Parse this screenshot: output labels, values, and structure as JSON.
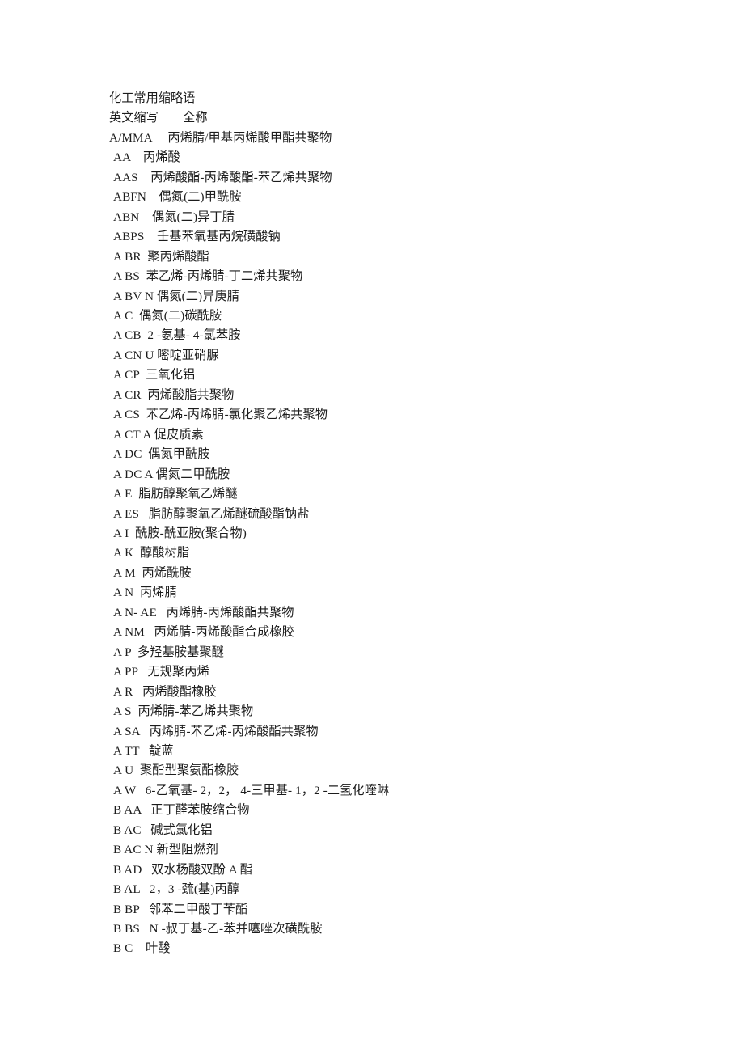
{
  "document": {
    "title": "化工常用缩略语",
    "column_header": "英文缩写　　全称",
    "header_parts": {
      "col1": "英文缩写",
      "col2": "全称"
    }
  },
  "entries": [
    {
      "abbr": "A/MMA",
      "gap": "     ",
      "name": "丙烯腈/甲基丙烯酸甲酯共聚物",
      "flush": true
    },
    {
      "abbr": "AA",
      "gap": "    ",
      "name": "丙烯酸"
    },
    {
      "abbr": "AAS",
      "gap": "    ",
      "name": "丙烯酸酯-丙烯酸酯-苯乙烯共聚物"
    },
    {
      "abbr": "ABFN",
      "gap": "    ",
      "name": "偶氮(二)甲酰胺"
    },
    {
      "abbr": "ABN",
      "gap": "    ",
      "name": "偶氮(二)异丁腈"
    },
    {
      "abbr": "ABPS",
      "gap": "    ",
      "name": "壬基苯氧基丙烷磺酸钠"
    },
    {
      "abbr": "A BR",
      "gap": "  ",
      "name": "聚丙烯酸酯"
    },
    {
      "abbr": "A BS",
      "gap": "  ",
      "name": "苯乙烯-丙烯腈-丁二烯共聚物"
    },
    {
      "abbr": "A BV N",
      "gap": " ",
      "name": "偶氮(二)异庚腈"
    },
    {
      "abbr": "A C",
      "gap": "  ",
      "name": "偶氮(二)碳酰胺"
    },
    {
      "abbr": "A CB",
      "gap": "  ",
      "name": "2 -氨基- 4-氯苯胺"
    },
    {
      "abbr": "A CN U",
      "gap": " ",
      "name": "嘧啶亚硝脲"
    },
    {
      "abbr": "A CP",
      "gap": "  ",
      "name": "三氧化铝"
    },
    {
      "abbr": "A CR",
      "gap": "  ",
      "name": "丙烯酸脂共聚物"
    },
    {
      "abbr": "A CS",
      "gap": "  ",
      "name": "苯乙烯-丙烯腈-氯化聚乙烯共聚物"
    },
    {
      "abbr": "A CT A",
      "gap": " ",
      "name": "促皮质素"
    },
    {
      "abbr": "A DC",
      "gap": "  ",
      "name": "偶氮甲酰胺"
    },
    {
      "abbr": "A DC A",
      "gap": " ",
      "name": "偶氮二甲酰胺"
    },
    {
      "abbr": "A E",
      "gap": "  ",
      "name": "脂肪醇聚氧乙烯醚"
    },
    {
      "abbr": "A ES",
      "gap": "   ",
      "name": "脂肪醇聚氧乙烯醚硫酸酯钠盐"
    },
    {
      "abbr": "A I",
      "gap": "  ",
      "name": "酰胺-酰亚胺(聚合物)"
    },
    {
      "abbr": "A K",
      "gap": "  ",
      "name": "醇酸树脂"
    },
    {
      "abbr": "A M",
      "gap": "  ",
      "name": "丙烯酰胺"
    },
    {
      "abbr": "A N",
      "gap": "  ",
      "name": "丙烯腈"
    },
    {
      "abbr": "A N- AE",
      "gap": "   ",
      "name": "丙烯腈-丙烯酸酯共聚物"
    },
    {
      "abbr": "A NM",
      "gap": "   ",
      "name": "丙烯腈-丙烯酸酯合成橡胶"
    },
    {
      "abbr": "A P",
      "gap": "  ",
      "name": "多羟基胺基聚醚"
    },
    {
      "abbr": "A PP",
      "gap": "   ",
      "name": "无规聚丙烯"
    },
    {
      "abbr": "A R",
      "gap": "   ",
      "name": "丙烯酸酯橡胶"
    },
    {
      "abbr": "A S",
      "gap": "  ",
      "name": "丙烯腈-苯乙烯共聚物"
    },
    {
      "abbr": "A SA",
      "gap": "   ",
      "name": "丙烯腈-苯乙烯-丙烯酸酯共聚物"
    },
    {
      "abbr": "A TT",
      "gap": "   ",
      "name": "靛蓝"
    },
    {
      "abbr": "A U",
      "gap": "  ",
      "name": "聚酯型聚氨酯橡胶"
    },
    {
      "abbr": "A W",
      "gap": "   ",
      "name": "6-乙氧基- 2，2， 4-三甲基- 1，2 -二氢化喹啉"
    },
    {
      "abbr": "B AA",
      "gap": "   ",
      "name": "正丁醛苯胺缩合物"
    },
    {
      "abbr": "B AC",
      "gap": "   ",
      "name": "碱式氯化铝"
    },
    {
      "abbr": "B AC N",
      "gap": " ",
      "name": "新型阻燃剂"
    },
    {
      "abbr": "B AD",
      "gap": "   ",
      "name": "双水杨酸双酚 A 酯"
    },
    {
      "abbr": "B AL",
      "gap": "   ",
      "name": "2，3 -巯(基)丙醇"
    },
    {
      "abbr": "B BP",
      "gap": "   ",
      "name": "邻苯二甲酸丁苄酯"
    },
    {
      "abbr": "B BS",
      "gap": "   ",
      "name": "N -叔丁基-乙-苯并噻唑次磺酰胺"
    },
    {
      "abbr": "B C",
      "gap": "    ",
      "name": "叶酸"
    }
  ],
  "colors": {
    "page_background": "#ffffff",
    "text": "#1c1c1c"
  }
}
